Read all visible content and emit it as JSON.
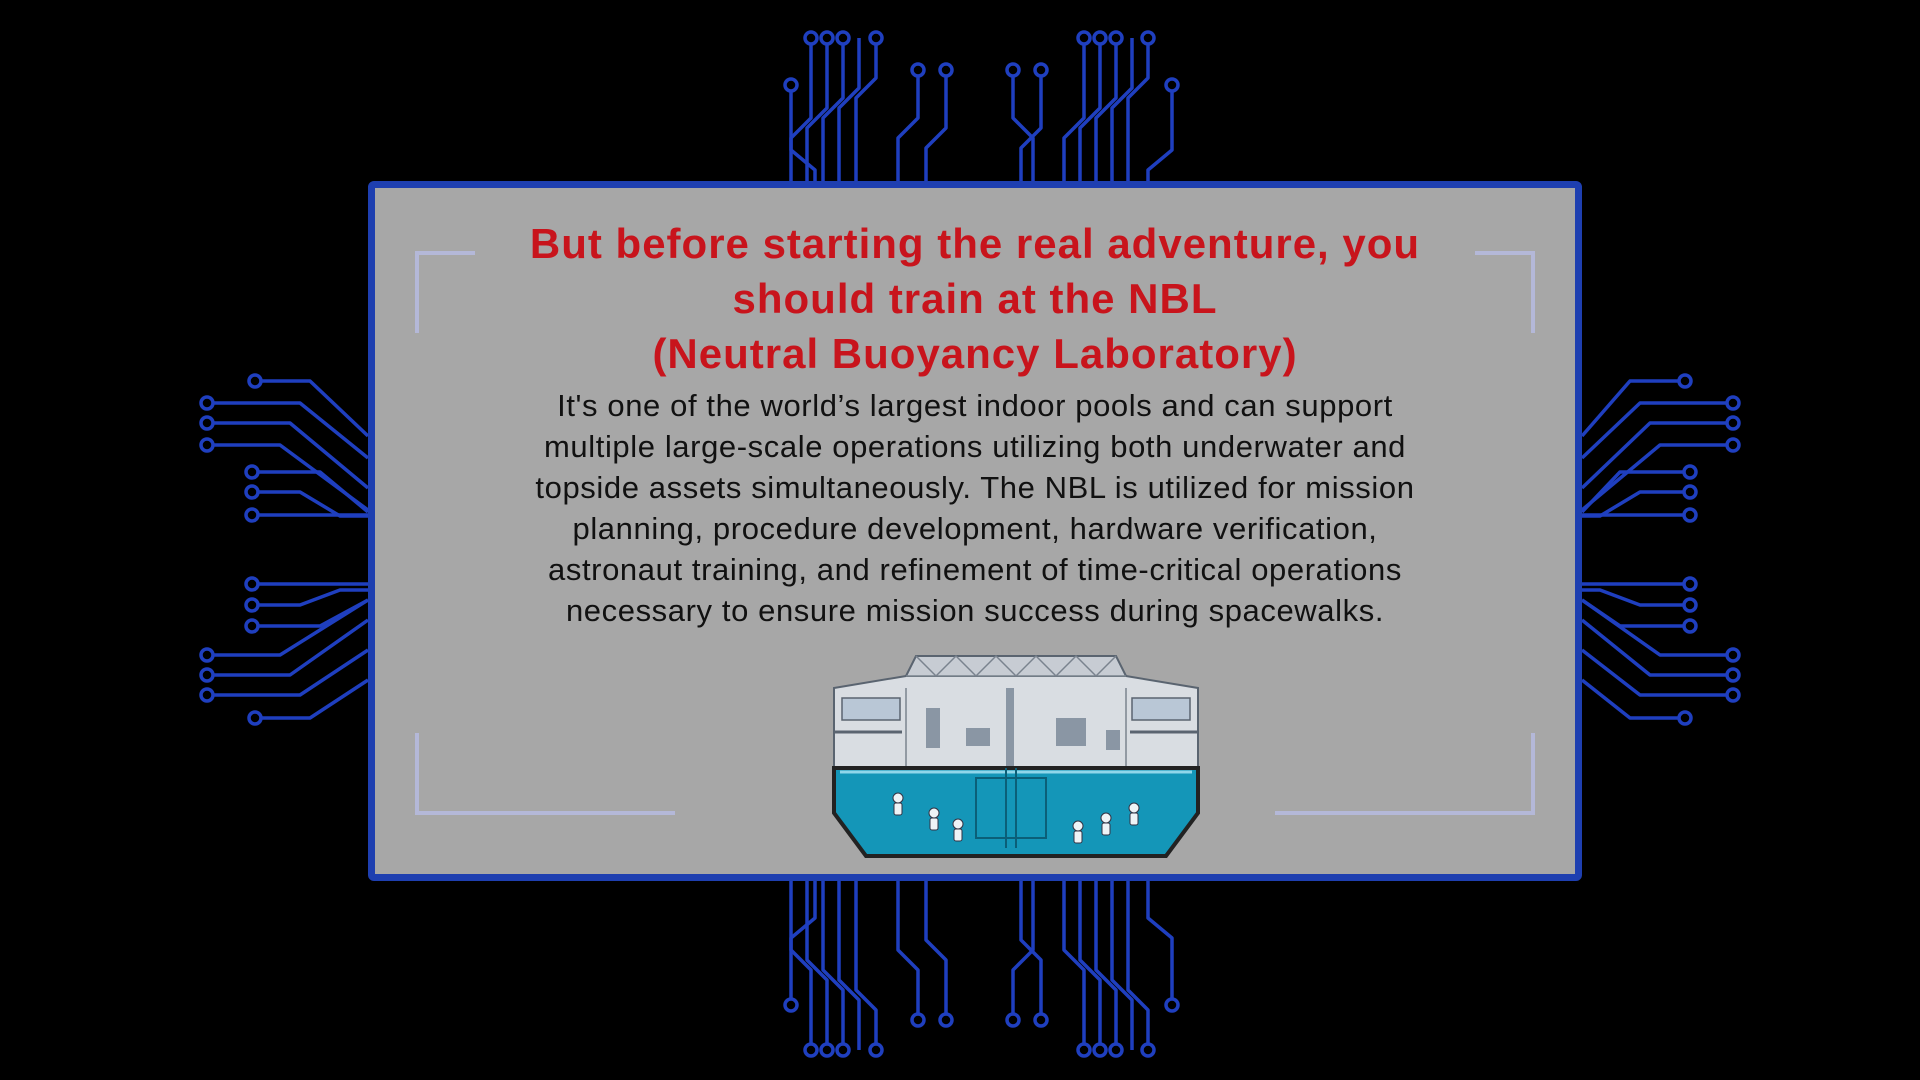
{
  "dialog": {
    "title_lines": [
      "But before starting the real adventure, you",
      "should train at the NBL",
      "(Neutral Buoyancy Laboratory)"
    ],
    "body_lines": [
      "It's one of the world’s largest indoor pools and can support",
      "multiple large-scale operations utilizing both underwater and",
      "topside assets simultaneously. The NBL is utilized for mission",
      "planning, procedure development, hardware verification,",
      "astronaut training, and refinement of time-critical operations",
      "necessary to ensure mission success during spacewalks."
    ],
    "illustration": "neutral-buoyancy-pool-illustration"
  },
  "colors": {
    "background": "#000000",
    "circuit": "#1f3fbf",
    "panel_fill": "#a7a7a7",
    "panel_border": "#1e3fb0",
    "title": "#c8141c",
    "body": "#111111",
    "water": "#1496b8"
  }
}
